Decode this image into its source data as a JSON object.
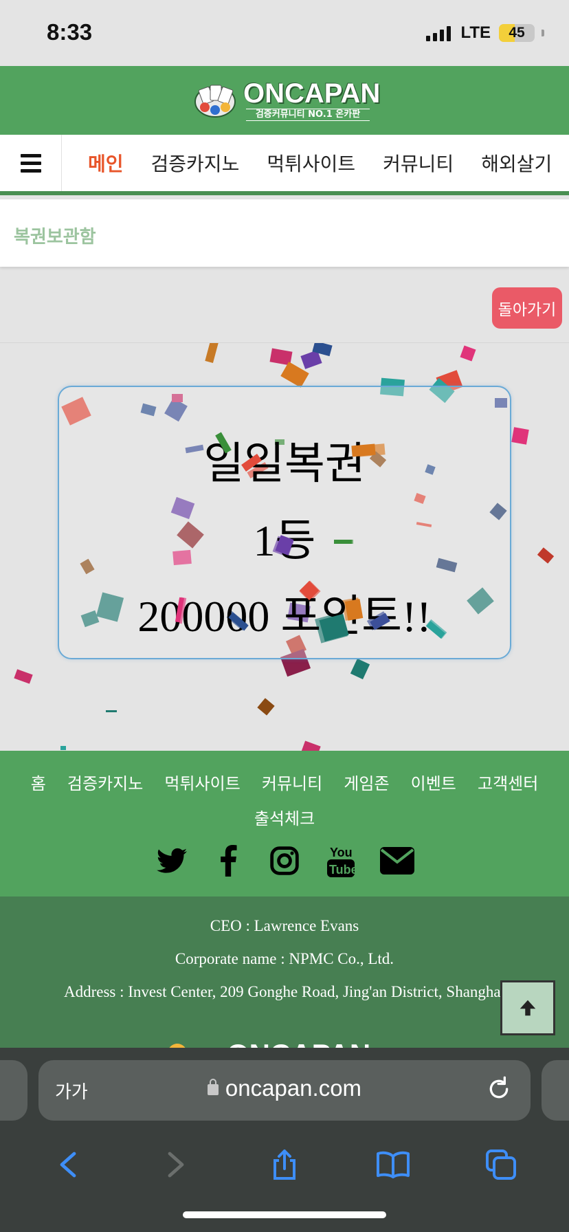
{
  "status_bar": {
    "time": "8:33",
    "network": "LTE",
    "battery": "45",
    "battery_level": 0.45
  },
  "header": {
    "logo_title": "ONCAPAN",
    "logo_subtitle": "검증커뮤니티 NO.1 온카판"
  },
  "nav": {
    "items": [
      "메인",
      "검증카지노",
      "먹튀사이트",
      "커뮤니티",
      "해외살기"
    ]
  },
  "breadcrumb": {
    "title": "복권보관함"
  },
  "back_button": {
    "label": "돌아가기"
  },
  "prize": {
    "line1": "일일복권",
    "line2": "1등",
    "line3": "200000 포인트!!"
  },
  "footer": {
    "links": [
      "홈",
      "검증카지노",
      "먹튀사이트",
      "커뮤니티",
      "게임존",
      "이벤트",
      "고객센터",
      "출석체크"
    ],
    "social": [
      "twitter-icon",
      "facebook-icon",
      "instagram-icon",
      "youtube-icon",
      "email-icon"
    ],
    "ceo": "CEO : Lawrence Evans",
    "corporate": "Corporate name : NPMC Co., Ltd.",
    "address": "Address : Invest Center, 209 Gonghe Road, Jing'an District, Shanghai"
  },
  "browser": {
    "aa_label": "가가",
    "domain": "oncapan.com"
  },
  "colors": {
    "header_green": "#52a35e",
    "footer_dark_green": "#477f52",
    "nav_active": "#e8552a",
    "back_button": "#ea5a67",
    "card_border": "#6aaad6"
  }
}
